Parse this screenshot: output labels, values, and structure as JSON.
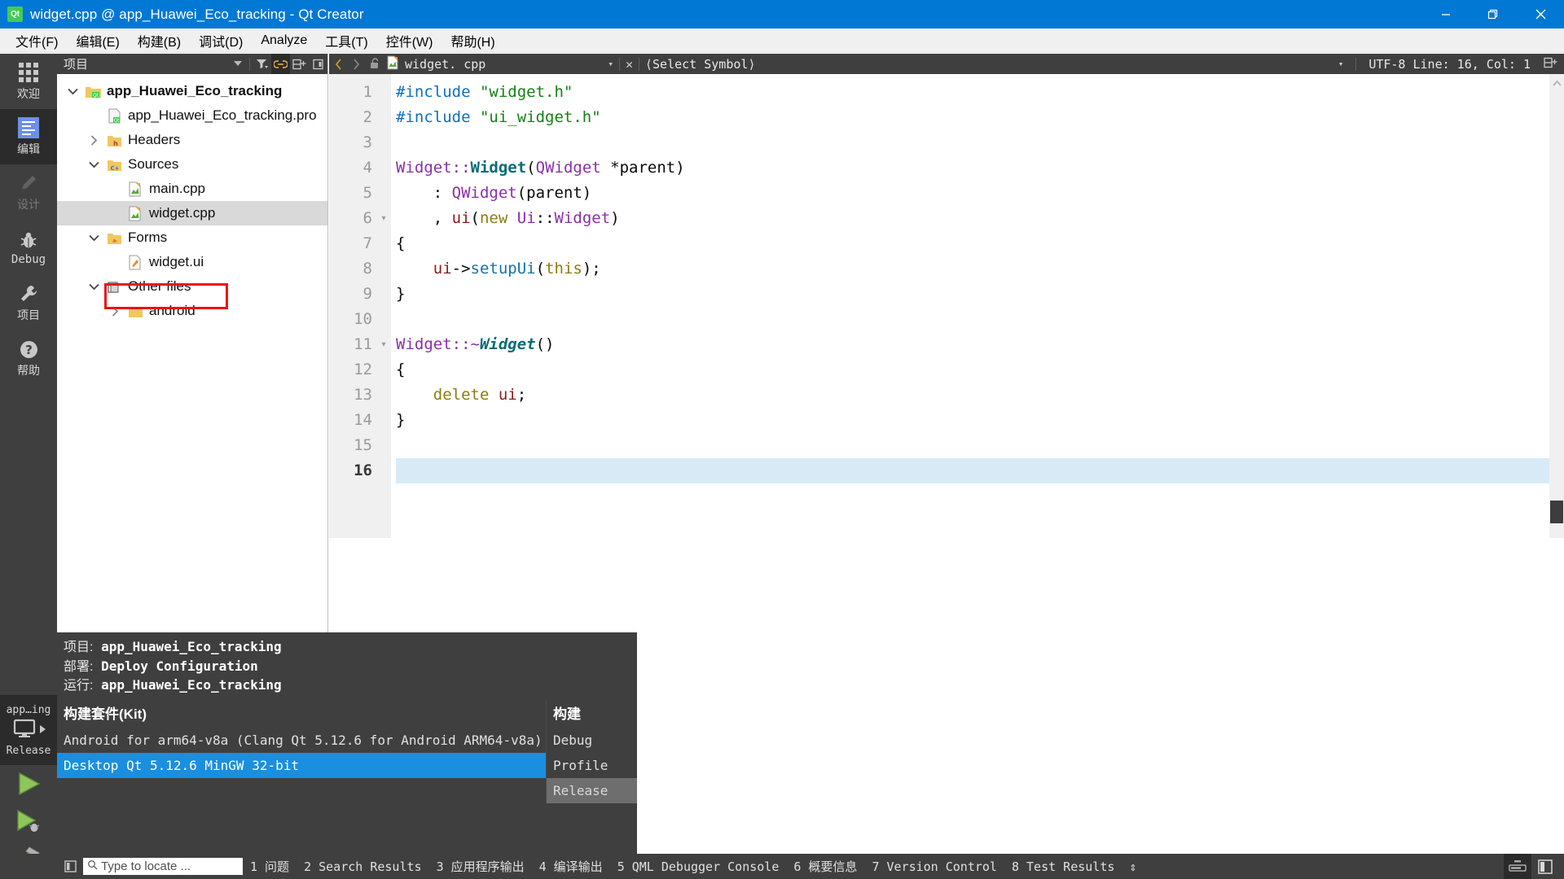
{
  "window": {
    "title": "widget.cpp @ app_Huawei_Eco_tracking - Qt Creator",
    "app_icon": "qt-logo-icon",
    "controls": {
      "minimize": "minimize-icon",
      "restore": "restore-icon",
      "close": "close-icon"
    }
  },
  "menubar": {
    "items": [
      {
        "label": "文件(F)",
        "name": "menu-file"
      },
      {
        "label": "编辑(E)",
        "name": "menu-edit"
      },
      {
        "label": "构建(B)",
        "name": "menu-build"
      },
      {
        "label": "调试(D)",
        "name": "menu-debug"
      },
      {
        "label": "Analyze",
        "name": "menu-analyze"
      },
      {
        "label": "工具(T)",
        "name": "menu-tools"
      },
      {
        "label": "控件(W)",
        "name": "menu-window"
      },
      {
        "label": "帮助(H)",
        "name": "menu-help"
      }
    ]
  },
  "modebar": {
    "items": [
      {
        "label": "欢迎",
        "icon": "grid-icon",
        "state": "normal"
      },
      {
        "label": "编辑",
        "icon": "edit-icon",
        "state": "active"
      },
      {
        "label": "设计",
        "icon": "pencil-icon",
        "state": "disabled"
      },
      {
        "label": "Debug",
        "icon": "bug-icon",
        "state": "normal"
      },
      {
        "label": "项目",
        "icon": "wrench-icon",
        "state": "normal"
      },
      {
        "label": "帮助",
        "icon": "question-icon",
        "state": "normal"
      }
    ],
    "kit_button": {
      "project": "app…ing",
      "config": "Release",
      "icon": "desktop-icon",
      "arrow": "triangle-right-icon"
    },
    "run_buttons": [
      {
        "name": "run-button",
        "icon": "play-icon"
      },
      {
        "name": "debug-run-button",
        "icon": "play-bug-icon"
      },
      {
        "name": "build-button",
        "icon": "hammer-icon"
      }
    ]
  },
  "project_panel": {
    "title": "项目",
    "toolbar": [
      {
        "name": "dropdown-icon",
        "glyph": "▾"
      },
      {
        "name": "filter-icon",
        "glyph": "filter"
      },
      {
        "name": "link-icon",
        "glyph": "link",
        "active": true
      },
      {
        "name": "split-icon",
        "glyph": "split"
      },
      {
        "name": "close-panel-icon",
        "glyph": "panel"
      }
    ],
    "tree": [
      {
        "label": "app_Huawei_Eco_tracking",
        "indent": 1,
        "arrow": "down",
        "icon": "qt-project-icon",
        "bold": true,
        "selected": false
      },
      {
        "label": "app_Huawei_Eco_tracking.pro",
        "indent": 2,
        "arrow": "none",
        "icon": "qt-file-icon",
        "bold": false,
        "selected": false
      },
      {
        "label": "Headers",
        "indent": 2,
        "arrow": "right",
        "icon": "folder-h-icon",
        "bold": false,
        "selected": false
      },
      {
        "label": "Sources",
        "indent": 2,
        "arrow": "down",
        "icon": "folder-cpp-icon",
        "bold": false,
        "selected": false
      },
      {
        "label": "main.cpp",
        "indent": 3,
        "arrow": "none",
        "icon": "cpp-file-icon",
        "bold": false,
        "selected": false
      },
      {
        "label": "widget.cpp",
        "indent": 3,
        "arrow": "none",
        "icon": "cpp-file-icon",
        "bold": false,
        "selected": true
      },
      {
        "label": "Forms",
        "indent": 2,
        "arrow": "down",
        "icon": "folder-ui-icon",
        "bold": false,
        "selected": false
      },
      {
        "label": "widget.ui",
        "indent": 3,
        "arrow": "none",
        "icon": "ui-file-icon",
        "bold": false,
        "selected": false,
        "highlight_box": true
      },
      {
        "label": "Other files",
        "indent": 2,
        "arrow": "down",
        "icon": "other-files-icon",
        "bold": false,
        "selected": false
      },
      {
        "label": "android",
        "indent": 3,
        "arrow": "right",
        "icon": "folder-icon",
        "bold": false,
        "selected": false
      }
    ]
  },
  "editor": {
    "toolbar": {
      "back_icon": "back-arrow-icon",
      "forward_icon": "forward-arrow-icon",
      "lock_icon": "unlock-icon",
      "file_icon": "cpp-file-icon",
      "filename": "widget. cpp",
      "dropdown": "▾",
      "close": "✕",
      "symbol_selector": "⟨Select Symbol⟩",
      "encoding_and_position": "UTF-8 Line: 16, Col: 1",
      "split_icon": "split-editor-icon"
    },
    "current_line": 16,
    "total_lines": 16,
    "lines": [
      {
        "n": 1,
        "fold": "",
        "tokens": [
          {
            "t": "#include ",
            "c": "pre"
          },
          {
            "t": "\"widget.h\"",
            "c": "str"
          }
        ]
      },
      {
        "n": 2,
        "fold": "",
        "tokens": [
          {
            "t": "#include ",
            "c": "pre"
          },
          {
            "t": "\"ui_widget.h\"",
            "c": "str"
          }
        ]
      },
      {
        "n": 3,
        "fold": "",
        "tokens": []
      },
      {
        "n": 4,
        "fold": "",
        "tokens": [
          {
            "t": "Widget",
            "c": "cls"
          },
          {
            "t": "::",
            "c": "cls"
          },
          {
            "t": "Widget",
            "c": "fn"
          },
          {
            "t": "(",
            "c": "plain"
          },
          {
            "t": "QWidget",
            "c": "cls"
          },
          {
            "t": " *parent)",
            "c": "plain"
          }
        ]
      },
      {
        "n": 5,
        "fold": "",
        "tokens": [
          {
            "t": "    : ",
            "c": "plain"
          },
          {
            "t": "QWidget",
            "c": "cls"
          },
          {
            "t": "(parent)",
            "c": "plain"
          }
        ]
      },
      {
        "n": 6,
        "fold": "▾",
        "tokens": [
          {
            "t": "    , ",
            "c": "plain"
          },
          {
            "t": "ui",
            "c": "field"
          },
          {
            "t": "(",
            "c": "plain"
          },
          {
            "t": "new",
            "c": "kw"
          },
          {
            "t": " ",
            "c": "plain"
          },
          {
            "t": "Ui",
            "c": "cls"
          },
          {
            "t": "::",
            "c": "plain"
          },
          {
            "t": "Widget",
            "c": "cls"
          },
          {
            "t": ")",
            "c": "plain"
          }
        ]
      },
      {
        "n": 7,
        "fold": "",
        "tokens": [
          {
            "t": "{",
            "c": "plain"
          }
        ]
      },
      {
        "n": 8,
        "fold": "",
        "tokens": [
          {
            "t": "    ",
            "c": "plain"
          },
          {
            "t": "ui",
            "c": "field"
          },
          {
            "t": "->",
            "c": "plain"
          },
          {
            "t": "setupUi",
            "c": "fncall"
          },
          {
            "t": "(",
            "c": "plain"
          },
          {
            "t": "this",
            "c": "kw"
          },
          {
            "t": ");",
            "c": "plain"
          }
        ]
      },
      {
        "n": 9,
        "fold": "",
        "tokens": [
          {
            "t": "}",
            "c": "plain"
          }
        ]
      },
      {
        "n": 10,
        "fold": "",
        "tokens": []
      },
      {
        "n": 11,
        "fold": "▾",
        "tokens": [
          {
            "t": "Widget",
            "c": "cls"
          },
          {
            "t": "::~",
            "c": "cls"
          },
          {
            "t": "Widget",
            "c": "fnit"
          },
          {
            "t": "()",
            "c": "plain"
          }
        ]
      },
      {
        "n": 12,
        "fold": "",
        "tokens": [
          {
            "t": "{",
            "c": "plain"
          }
        ]
      },
      {
        "n": 13,
        "fold": "",
        "tokens": [
          {
            "t": "    ",
            "c": "plain"
          },
          {
            "t": "delete",
            "c": "kw"
          },
          {
            "t": " ",
            "c": "plain"
          },
          {
            "t": "ui",
            "c": "field"
          },
          {
            "t": ";",
            "c": "plain"
          }
        ]
      },
      {
        "n": 14,
        "fold": "",
        "tokens": [
          {
            "t": "}",
            "c": "plain"
          }
        ]
      },
      {
        "n": 15,
        "fold": "",
        "tokens": []
      },
      {
        "n": 16,
        "fold": "",
        "tokens": []
      }
    ]
  },
  "kit_popup": {
    "info": [
      {
        "label": "项目:",
        "value": "app_Huawei_Eco_tracking"
      },
      {
        "label": "部署:",
        "value": "Deploy Configuration"
      },
      {
        "label": "运行:",
        "value": "app_Huawei_Eco_tracking"
      }
    ],
    "kit_column_header": "构建套件(Kit)",
    "build_column_header": "构建",
    "kits": [
      {
        "label": "Android for arm64-v8a (Clang Qt 5.12.6 for Android ARM64-v8a)",
        "state": "normal"
      },
      {
        "label": "Desktop Qt 5.12.6 MinGW 32-bit",
        "state": "selected"
      }
    ],
    "builds": [
      {
        "label": "Debug",
        "state": "normal"
      },
      {
        "label": "Profile",
        "state": "normal"
      },
      {
        "label": "Release",
        "state": "highlighted"
      }
    ]
  },
  "statusbar": {
    "sidebar_icon": "sidebar-toggle-icon",
    "locator_placeholder": "Type to locate ...",
    "locator_icon": "search-icon",
    "items": [
      "1 问题",
      "2 Search Results",
      "3 应用程序输出",
      "4 编译输出",
      "5 QML Debugger Console",
      "6 概要信息",
      "7 Version Control",
      "8 Test Results"
    ],
    "updown_glyph": "⇕",
    "right_toggles": [
      {
        "name": "output-pane-toggle",
        "active": true
      },
      {
        "name": "right-sidebar-toggle",
        "active": false
      }
    ]
  },
  "colors": {
    "titlebar": "#0078d4",
    "dark_chrome": "#3f3f3f",
    "dark_chrome_active": "#2b2b2b",
    "selection_blue": "#1a8fe0",
    "annotation_red": "#ee1111",
    "current_line": "#d9eaf7"
  }
}
